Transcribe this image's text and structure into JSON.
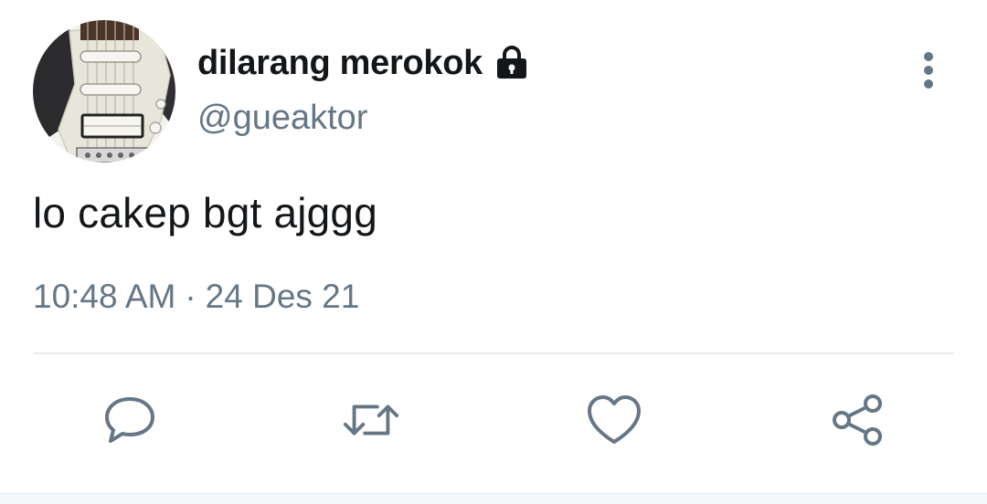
{
  "user": {
    "display_name": "dilarang merokok",
    "handle": "@gueaktor",
    "protected_icon": "lock-icon",
    "avatar": "guitar-photo"
  },
  "tweet": {
    "text": "lo cakep bgt ajggg",
    "time": "10:48 AM",
    "separator": "·",
    "date": "24 Des 21"
  },
  "actions": [
    {
      "name": "reply",
      "icon": "speech-bubble-icon"
    },
    {
      "name": "retweet",
      "icon": "retweet-arrows-icon"
    },
    {
      "name": "like",
      "icon": "heart-icon"
    },
    {
      "name": "share",
      "icon": "share-nodes-icon"
    }
  ],
  "more_menu_icon": "vertical-dots-icon",
  "colors": {
    "text_primary": "#14171a",
    "text_secondary": "#657786",
    "icon": "#657786",
    "divider": "#e6ecf0"
  }
}
